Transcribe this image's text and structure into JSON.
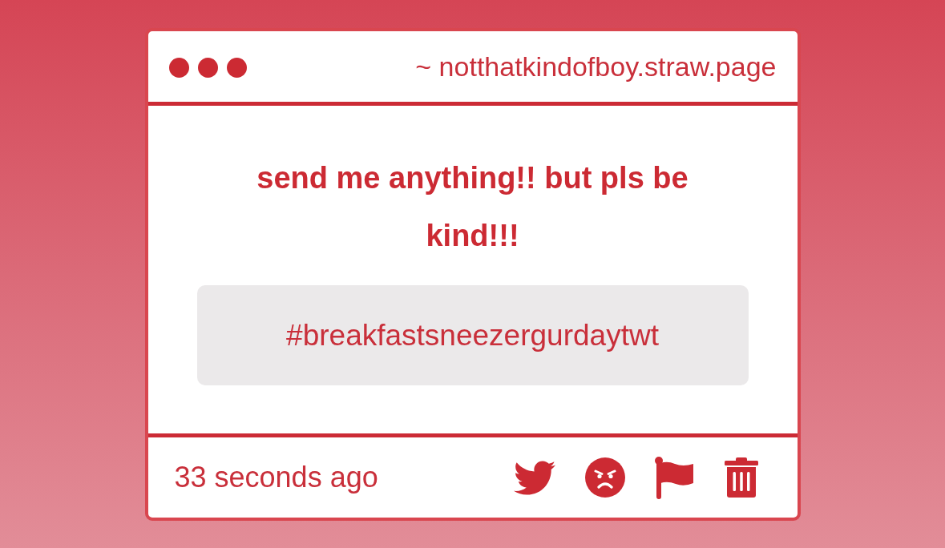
{
  "header": {
    "url": "~ notthatkindofboy.straw.page"
  },
  "message": {
    "prompt": "send me anything!! but pls be kind!!!",
    "answer": "#breakfastsneezergurdaytwt"
  },
  "footer": {
    "time": "33 seconds ago",
    "actions": [
      {
        "kind": "bird"
      },
      {
        "kind": "angry"
      },
      {
        "kind": "flag"
      },
      {
        "kind": "trash"
      }
    ]
  }
}
